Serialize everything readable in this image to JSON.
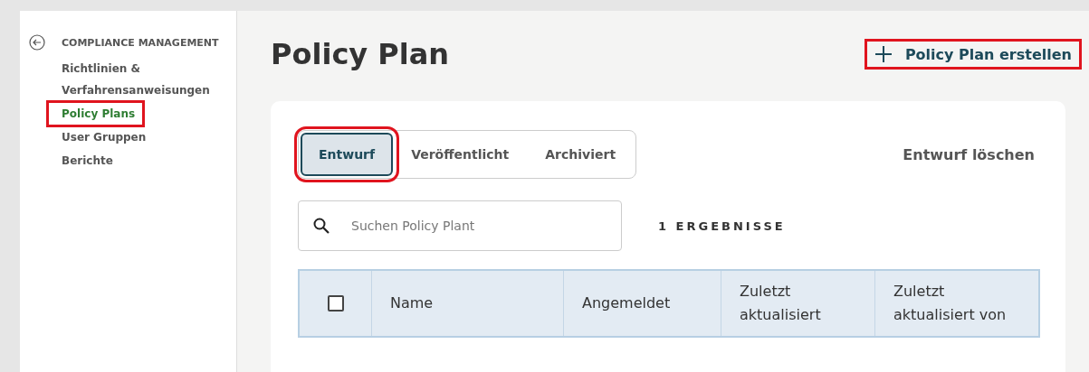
{
  "sidebar": {
    "section_title": "COMPLIANCE MANAGEMENT",
    "items": [
      {
        "label": "Richtlinien & Verfahrensanweisungen",
        "selected": false,
        "highlighted": false
      },
      {
        "label": "Policy Plans",
        "selected": true,
        "highlighted": true
      },
      {
        "label": "User Gruppen",
        "selected": false,
        "highlighted": false
      },
      {
        "label": "Berichte",
        "selected": false,
        "highlighted": false
      }
    ]
  },
  "page": {
    "title": "Policy Plan",
    "create_button": {
      "label": "Policy Plan erstellen",
      "highlighted": true
    }
  },
  "tabs": [
    {
      "label": "Entwurf",
      "selected": true,
      "highlighted": true
    },
    {
      "label": "Veröffentlicht",
      "selected": false,
      "highlighted": false
    },
    {
      "label": "Archiviert",
      "selected": false,
      "highlighted": false
    }
  ],
  "delete_draft": "Entwurf löschen",
  "search": {
    "placeholder": "Suchen Policy Plant"
  },
  "result_count": "1 ERGEBNISSE",
  "table": {
    "select_all_checked": false,
    "columns": [
      "Name",
      "Angemeldet",
      "Zuletzt aktualisiert",
      "Zuletzt aktualisiert von"
    ]
  }
}
